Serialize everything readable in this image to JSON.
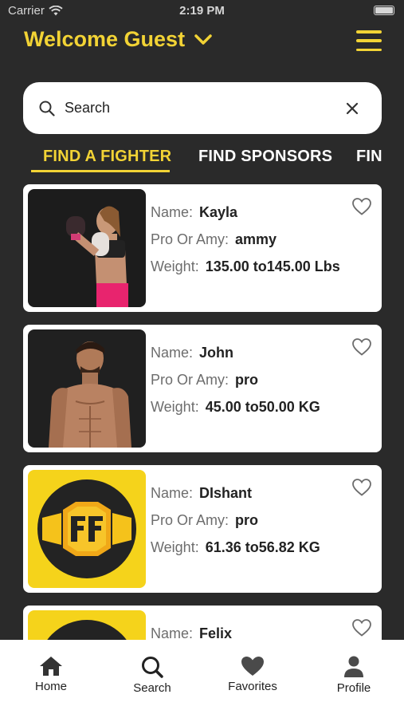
{
  "status_bar": {
    "carrier": "Carrier",
    "time": "2:19 PM"
  },
  "header": {
    "welcome": "Welcome Guest"
  },
  "search": {
    "placeholder": "Search"
  },
  "tabs": [
    "FIND A FIGHTER",
    "FIND SPONSORS",
    "FIN"
  ],
  "labels": {
    "name": "Name:",
    "pro": "Pro Or Amy:",
    "weight": "Weight:"
  },
  "fighters": [
    {
      "name": "Kayla",
      "pro": "ammy",
      "weight": "135.00 to145.00 Lbs",
      "photo": "female-boxer-photo"
    },
    {
      "name": "John",
      "pro": "pro",
      "weight": "45.00 to50.00 KG",
      "photo": "male-fighter-photo"
    },
    {
      "name": "DIshant",
      "pro": "pro",
      "weight": "61.36 to56.82 KG",
      "photo": "ff-belt-logo"
    },
    {
      "name": "Felix",
      "pro": "",
      "weight": "",
      "photo": "ff-belt-logo"
    }
  ],
  "tabbar": {
    "home": "Home",
    "search": "Search",
    "favorites": "Favorites",
    "profile": "Profile"
  },
  "colors": {
    "accent": "#f2d335",
    "background": "#2a2a2a"
  }
}
